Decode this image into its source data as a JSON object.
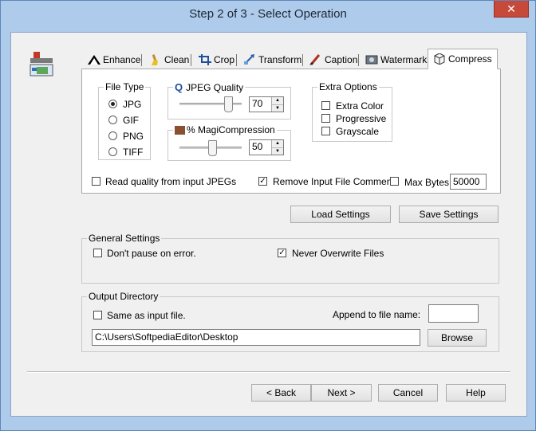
{
  "window": {
    "title": "Step 2 of 3 - Select Operation",
    "close_glyph": "✕"
  },
  "tabs": [
    {
      "label": "Enhance",
      "icon": "enhance-icon"
    },
    {
      "label": "Clean",
      "icon": "clean-icon"
    },
    {
      "label": "Crop",
      "icon": "crop-icon"
    },
    {
      "label": "Transform",
      "icon": "transform-icon"
    },
    {
      "label": "Caption",
      "icon": "caption-icon"
    },
    {
      "label": "Watermark",
      "icon": "watermark-icon"
    },
    {
      "label": "Compress",
      "icon": "compress-icon",
      "active": true
    }
  ],
  "compress": {
    "file_type": {
      "title": "File Type",
      "options": [
        "JPG",
        "GIF",
        "PNG",
        "TIFF"
      ],
      "selected": "JPG"
    },
    "jpeg_quality": {
      "title": "JPEG Quality",
      "value": "70",
      "level": 70
    },
    "magi_compression": {
      "title": "% MagiCompression",
      "value": "50",
      "level": 50
    },
    "extra_options": {
      "title": "Extra Options",
      "items": [
        {
          "label": "Extra Color",
          "checked": false
        },
        {
          "label": "Progressive",
          "checked": false
        },
        {
          "label": "Grayscale",
          "checked": false
        }
      ]
    },
    "read_quality": {
      "label": "Read quality from input JPEGs",
      "checked": false
    },
    "remove_comment": {
      "label": "Remove Input File Comment",
      "checked": true
    },
    "max_bytes": {
      "label": "Max Bytes:",
      "checked": false,
      "value": "50000"
    }
  },
  "buttons": {
    "load_settings": "Load Settings",
    "save_settings": "Save Settings",
    "back": "< Back",
    "next": "Next >",
    "cancel": "Cancel",
    "help": "Help",
    "browse": "Browse"
  },
  "general": {
    "title": "General Settings",
    "dont_pause": {
      "label": "Don't pause on error.",
      "checked": false
    },
    "never_overwrite": {
      "label": "Never Overwrite Files",
      "checked": true
    }
  },
  "output": {
    "title": "Output Directory",
    "same_as_input": {
      "label": "Same as input file.",
      "checked": false
    },
    "append_label": "Append to file name:",
    "append_value": "",
    "path": "C:\\Users\\SoftpediaEditor\\Desktop"
  },
  "check_glyph": "✓"
}
